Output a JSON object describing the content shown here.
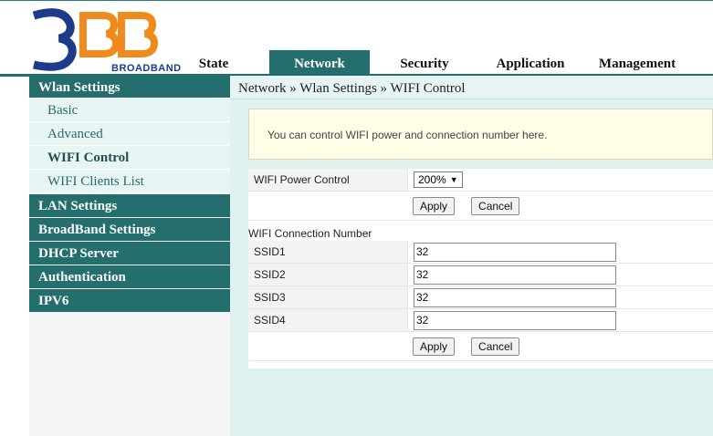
{
  "logo": {
    "brand": "BROADBAND"
  },
  "nav": {
    "items": [
      {
        "label": "State"
      },
      {
        "label": "Network"
      },
      {
        "label": "Security"
      },
      {
        "label": "Application"
      },
      {
        "label": "Management"
      }
    ]
  },
  "sidebar": {
    "wlan": {
      "header": "Wlan Settings",
      "items": [
        {
          "label": "Basic"
        },
        {
          "label": "Advanced"
        },
        {
          "label": "WIFI Control"
        },
        {
          "label": "WIFI Clients List"
        }
      ]
    },
    "groups": [
      {
        "label": "LAN Settings"
      },
      {
        "label": "BroadBand Settings"
      },
      {
        "label": "DHCP Server"
      },
      {
        "label": "Authentication"
      },
      {
        "label": "IPV6"
      }
    ]
  },
  "breadcrumb": "Network » Wlan Settings » WIFI Control",
  "notice": "You can control WIFI power and connection number here.",
  "power": {
    "label": "WIFI Power Control",
    "selected": "200%",
    "apply": "Apply",
    "cancel": "Cancel"
  },
  "connection": {
    "title": "WIFI Connection Number",
    "rows": [
      {
        "label": "SSID1",
        "value": "32"
      },
      {
        "label": "SSID2",
        "value": "32"
      },
      {
        "label": "SSID3",
        "value": "32"
      },
      {
        "label": "SSID4",
        "value": "32"
      }
    ],
    "apply": "Apply",
    "cancel": "Cancel"
  },
  "colors": {
    "accent": "#246e6e",
    "notice_bg": "#fffde6",
    "main_bg": "#dff2f0"
  }
}
